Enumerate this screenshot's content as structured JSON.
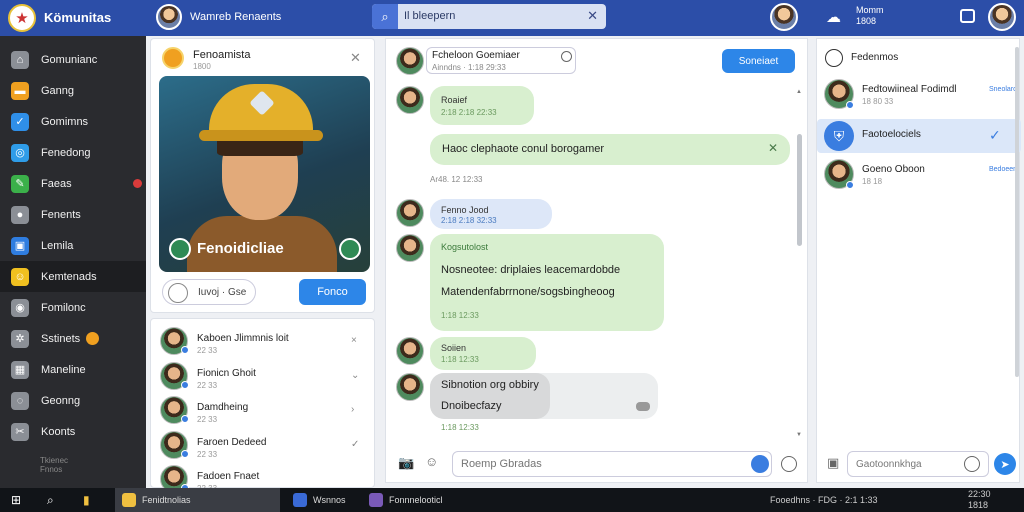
{
  "app": {
    "title": "Kömunitas"
  },
  "topbar": {
    "user_name": "Wamreb Renaents",
    "search_value": "Il bleepern",
    "count_lines": [
      "Momm",
      "1808"
    ]
  },
  "nav": {
    "items": [
      {
        "label": "Gomunianc",
        "icon": "house-icon",
        "color": "#8b8f96",
        "badge": false,
        "dot": false
      },
      {
        "label": "Ganng",
        "icon": "folder-icon",
        "color": "#f0a020",
        "badge": false,
        "dot": false
      },
      {
        "label": "Gomimns",
        "icon": "checkmark-icon",
        "color": "#2f8fe8",
        "badge": false,
        "dot": false
      },
      {
        "label": "Fenedong",
        "icon": "globe-icon",
        "color": "#2f9ce8",
        "badge": false,
        "dot": false
      },
      {
        "label": "Faeas",
        "icon": "pencil-icon",
        "color": "#3bb04a",
        "badge": false,
        "dot": true
      },
      {
        "label": "Fenents",
        "icon": "person-icon",
        "color": "#8b8f96",
        "badge": false,
        "dot": false
      },
      {
        "label": "Lemila",
        "icon": "image-icon",
        "color": "#2f7de0",
        "badge": false,
        "dot": false
      },
      {
        "label": "Kemtenads",
        "icon": "emoji-icon",
        "color": "#f0c020",
        "badge": false,
        "dot": false
      },
      {
        "label": "Fomilonc",
        "icon": "camera-icon",
        "color": "#8b8f96",
        "badge": false,
        "dot": false
      },
      {
        "label": "Sstinets",
        "icon": "gear-icon",
        "color": "#8b8f96",
        "badge": true,
        "dot": false
      },
      {
        "label": "Maneline",
        "icon": "grid-icon",
        "color": "#8b8f96",
        "badge": false,
        "dot": false
      },
      {
        "label": "Geonng",
        "icon": "chat-icon",
        "color": "#8b8f96",
        "badge": false,
        "dot": false
      },
      {
        "label": "Koonts",
        "icon": "tools-icon",
        "color": "#8b8f96",
        "badge": false,
        "dot": false
      }
    ],
    "footer": [
      "Tkienec",
      "Fnnos"
    ]
  },
  "profile": {
    "name": "Fenoamista",
    "sub": "1800",
    "art_caption": "Fenoidicliae",
    "action_label": "Iuvoj · Gse",
    "button": "Fonco"
  },
  "contacts": [
    {
      "name": "Kaboen Jlimmnis loit",
      "time": "22 33",
      "action": "×"
    },
    {
      "name": "Fionicn Ghoit",
      "time": "22 33",
      "action": "⌄"
    },
    {
      "name": "Damdheing",
      "time": "22 33",
      "action": "›"
    },
    {
      "name": "Faroen Dedeed",
      "time": "22 33",
      "action": "✓"
    },
    {
      "name": "Fadoen Fnaet",
      "time": "22 33",
      "action": ""
    }
  ],
  "chat": {
    "header_name": "Fcheloon Goemiaer",
    "header_sub": "Ainndns · 1:18 29:33",
    "header_button": "Soneiaet",
    "messages": [
      {
        "sender": "Roaief",
        "time": "2:18 2:18 22:33",
        "lines": []
      },
      {
        "sender": "",
        "time": "",
        "lines": [
          "Haoc clephaote conul borogamer"
        ]
      },
      {
        "sender": "Fenno Jood",
        "time": "2:18 2:18 32:33",
        "lines": []
      },
      {
        "sender": "Kogsutolost",
        "time": "1:18 12:33",
        "lines": [
          "Nosneotee: driplaies leacemardobde",
          "Matendenfabrrnone/sogsbingheoog"
        ]
      },
      {
        "sender": "Soiien",
        "time": "1:18 12:33",
        "lines": []
      },
      {
        "sender": "",
        "time": "1:18 12:33",
        "lines": [
          "Sibnotion org obbiry",
          "Dnoibecfazy"
        ]
      }
    ],
    "meta_line": "Ar48. 12 12:33",
    "input_placeholder": "Roemp Gbradas"
  },
  "rightpanel": {
    "title": "Fedenmos",
    "items": [
      {
        "name": "Fedtowiineal Fodimdl",
        "sub": "18 80 33",
        "link": "Sneolaro",
        "check": false
      },
      {
        "name": "Faotoelociels",
        "sub": "",
        "link": "",
        "check": true
      },
      {
        "name": "Goeno Oboon",
        "sub": "18 18",
        "link": "Bedoeen",
        "check": false
      }
    ],
    "input": "Gaotoonnkhga"
  },
  "taskbar": {
    "apps": [
      "Fenidtnolias",
      "Wsnnos",
      "Fonnnelooticl"
    ],
    "tray": "Fooedhns · FDG · 2:1 1:33",
    "clock": [
      "22:30",
      "1818"
    ]
  }
}
